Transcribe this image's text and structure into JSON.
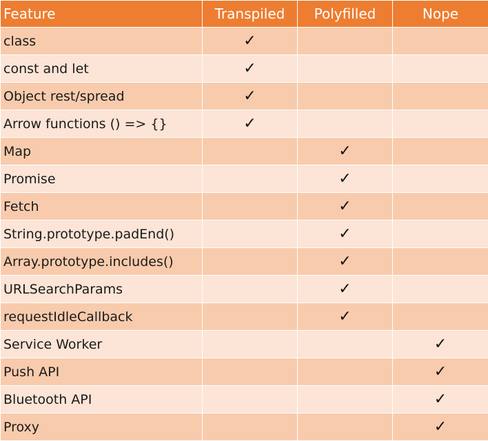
{
  "colors": {
    "header_bg": "#ED7D31",
    "row_dark": "#F8CBAD",
    "row_light": "#FCE4D6",
    "header_text": "#FFFFFF"
  },
  "check_icon": "✓",
  "columns": [
    "Feature",
    "Transpiled",
    "Polyfilled",
    "Nope"
  ],
  "rows": [
    {
      "feature": "class",
      "status": "Transpiled"
    },
    {
      "feature": "const and let",
      "status": "Transpiled"
    },
    {
      "feature": "Object rest/spread",
      "status": "Transpiled"
    },
    {
      "feature": "Arrow functions () => {}",
      "status": "Transpiled"
    },
    {
      "feature": "Map",
      "status": "Polyfilled"
    },
    {
      "feature": "Promise",
      "status": "Polyfilled"
    },
    {
      "feature": "Fetch",
      "status": "Polyfilled"
    },
    {
      "feature": "String.prototype.padEnd()",
      "status": "Polyfilled"
    },
    {
      "feature": "Array.prototype.includes()",
      "status": "Polyfilled"
    },
    {
      "feature": "URLSearchParams",
      "status": "Polyfilled"
    },
    {
      "feature": "requestIdleCallback",
      "status": "Polyfilled"
    },
    {
      "feature": "Service Worker",
      "status": "Nope"
    },
    {
      "feature": "Push API",
      "status": "Nope"
    },
    {
      "feature": "Bluetooth API",
      "status": "Nope"
    },
    {
      "feature": "Proxy",
      "status": "Nope"
    }
  ]
}
